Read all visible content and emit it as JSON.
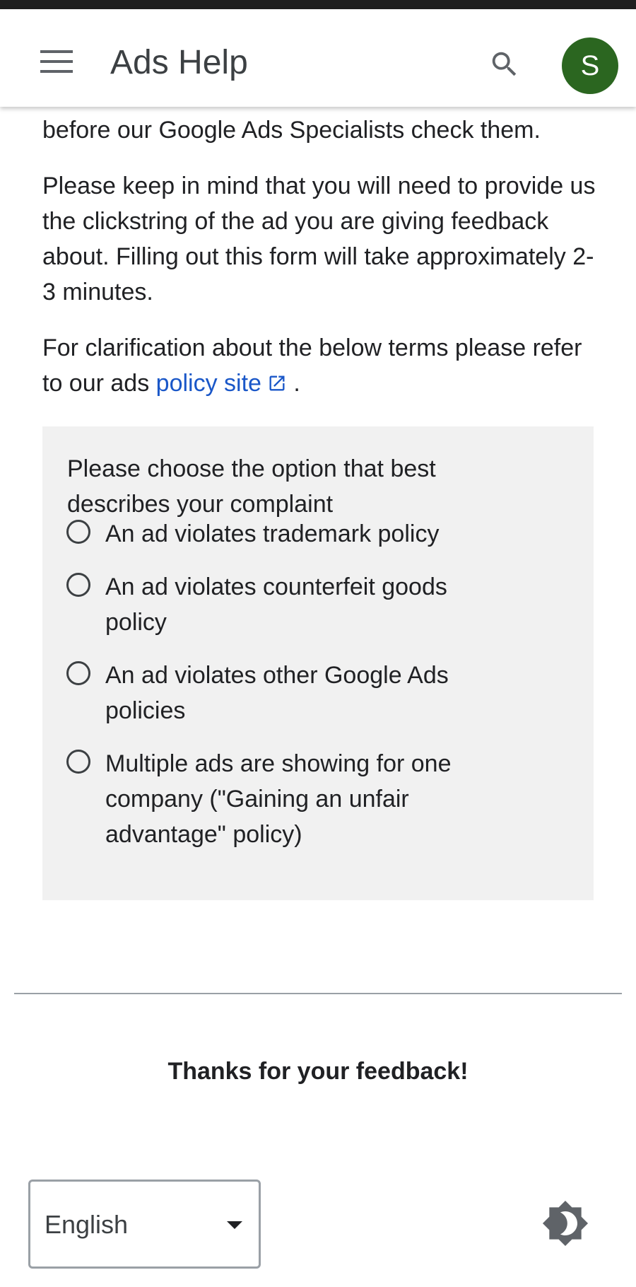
{
  "header": {
    "title": "Ads Help",
    "menu_icon": "hamburger-menu-icon",
    "search_icon": "search-icon",
    "avatar_initial": "S",
    "avatar_color": "#2b6620"
  },
  "intro": {
    "line_partial": "before our Google Ads Specialists check them.",
    "paragraph_clickstring": "Please keep in mind that you will need to provide us the clickstring of the ad you are giving feedback about. Filling out this form will take approximately 2-3 minutes.",
    "clarification_prefix": "For clarification about the below terms please refer to our ads ",
    "policy_link_text": "policy site",
    "policy_link_icon": "external-link-icon",
    "clarification_suffix": "."
  },
  "question": {
    "prompt": "Please choose the option that best describes your complaint",
    "options": [
      {
        "label": "An ad violates trademark policy",
        "selected": false
      },
      {
        "label": "An ad violates counterfeit goods policy",
        "selected": false
      },
      {
        "label": "An ad violates other Google Ads policies",
        "selected": false
      },
      {
        "label": "Multiple ads are showing for one company (\"Gaining an unfair advantage\" policy)",
        "selected": false
      }
    ]
  },
  "footer": {
    "feedback_thanks": "Thanks for your feedback!",
    "language_selected": "English",
    "theme_toggle_icon": "brightness-toggle-icon"
  },
  "colors": {
    "link": "#1a57c8",
    "card_background": "#f1f1f1",
    "text": "#202124"
  }
}
